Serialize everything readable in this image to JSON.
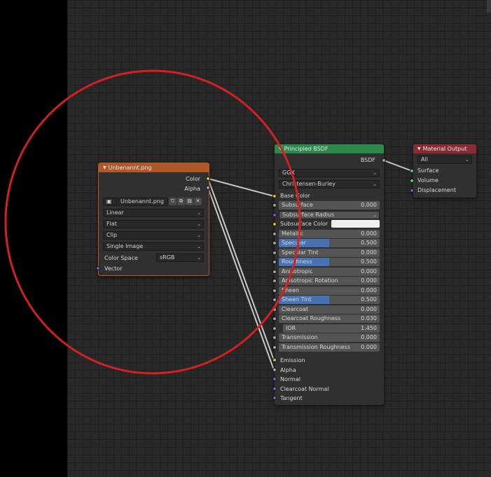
{
  "image_node": {
    "title": "Unbenannt.png",
    "outputs": [
      "Color",
      "Alpha"
    ],
    "image_name": "Unbenannt.png",
    "interpolation": "Linear",
    "projection": "Flat",
    "extension": "Clip",
    "source": "Single Image",
    "color_space_label": "Color Space",
    "color_space_value": "sRGB",
    "input_vector": "Vector",
    "header_color": "#b0582a"
  },
  "bsdf_node": {
    "title": "Principled BSDF",
    "output": "BSDF",
    "distribution": "GGX",
    "subsurface_method": "Christensen-Burley",
    "header_color": "#2c8a4c",
    "fields": [
      {
        "label": "Subsurface",
        "value": "0.000",
        "fill": 0
      },
      {
        "label": "Subsurface Radius",
        "value": "",
        "fill": 0
      },
      {
        "label": "Subsurface Color",
        "value": "",
        "fill": 0
      },
      {
        "label": "Metallic",
        "value": "0.000",
        "fill": 0
      },
      {
        "label": "Specular",
        "value": "0.500",
        "fill": 0.5
      },
      {
        "label": "Specular Tint",
        "value": "0.000",
        "fill": 0
      },
      {
        "label": "Roughness",
        "value": "0.500",
        "fill": 0.5
      },
      {
        "label": "Anisotropic",
        "value": "0.000",
        "fill": 0
      },
      {
        "label": "Anisotropic Rotation",
        "value": "0.000",
        "fill": 0
      },
      {
        "label": "Sheen",
        "value": "0.000",
        "fill": 0
      },
      {
        "label": "Sheen Tint",
        "value": "0.500",
        "fill": 0.5
      },
      {
        "label": "Clearcoat",
        "value": "0.000",
        "fill": 0
      },
      {
        "label": "Clearcoat Roughness",
        "value": "0.030",
        "fill": 0.03
      },
      {
        "label": "IOR",
        "value": "1.450",
        "fill": 0
      },
      {
        "label": "Transmission",
        "value": "0.000",
        "fill": 0
      },
      {
        "label": "Transmission Roughness",
        "value": "0.000",
        "fill": 0
      }
    ],
    "base_color_label": "Base Color",
    "emission_label": "Emission",
    "alpha_label": "Alpha",
    "normal_label": "Normal",
    "clearcoat_normal_label": "Clearcoat Normal",
    "tangent_label": "Tangent"
  },
  "output_node": {
    "title": "Material Output",
    "target": "All",
    "inputs": [
      "Surface",
      "Volume",
      "Displacement"
    ],
    "header_color": "#8a2a32"
  },
  "annotation_color": "#d42020"
}
